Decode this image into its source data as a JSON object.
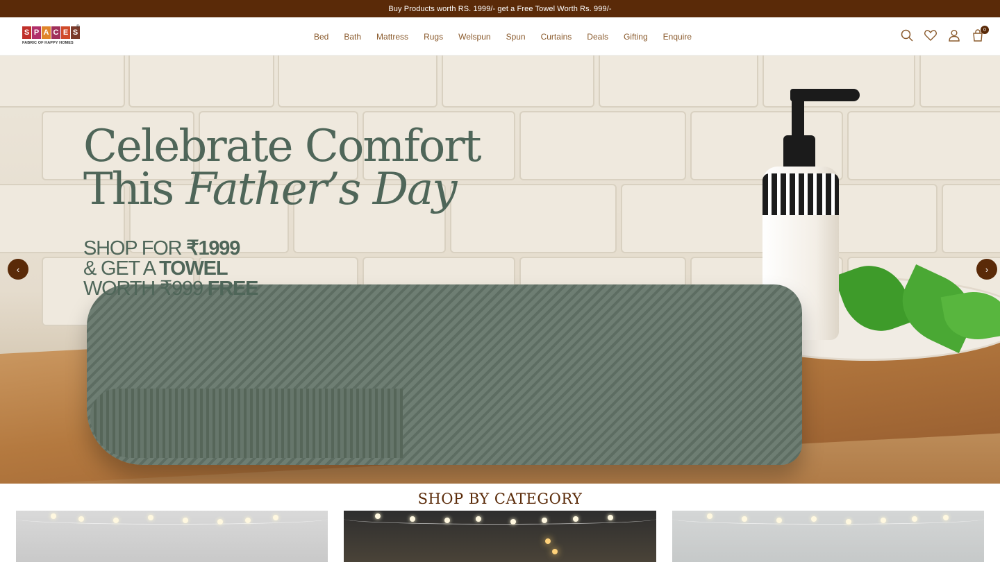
{
  "announcement": "Buy Products worth RS. 1999/- get a Free Towel Worth Rs. 999/-",
  "logo": {
    "letters": [
      "S",
      "P",
      "A",
      "C",
      "E",
      "S"
    ],
    "letter_colors": [
      "#c0302a",
      "#b02f6a",
      "#e0852a",
      "#a0305a",
      "#d04a2a",
      "#7a3a2a"
    ],
    "tagline": "FABRIC OF HAPPY HOMES",
    "registered": "®"
  },
  "nav": {
    "items": [
      "Bed",
      "Bath",
      "Mattress",
      "Rugs",
      "Welspun",
      "Spun",
      "Curtains",
      "Deals",
      "Gifting",
      "Enquire"
    ]
  },
  "header_icons": {
    "search": "search-icon",
    "wishlist": "heart-icon",
    "account": "user-icon",
    "cart": "bag-icon",
    "cart_count": "0"
  },
  "hero": {
    "title_line1": "Celebrate Comfort",
    "title_line2_plain": "This ",
    "title_line2_italic": "Father’s Day",
    "offer_line1_plain": "SHOP FOR ",
    "offer_line1_bold": "₹1999",
    "offer_line2_plain": "& GET A ",
    "offer_line2_bold": "TOWEL",
    "offer_line3_plain": "WORTH ₹999 ",
    "offer_line3_bold": "FREE",
    "prev_arrow": "‹",
    "next_arrow": "›"
  },
  "section": {
    "title": "SHOP BY CATEGORY"
  },
  "colors": {
    "brand": "#5a2a08",
    "nav_text": "#8a5a2c",
    "hero_text": "#4f6659"
  }
}
